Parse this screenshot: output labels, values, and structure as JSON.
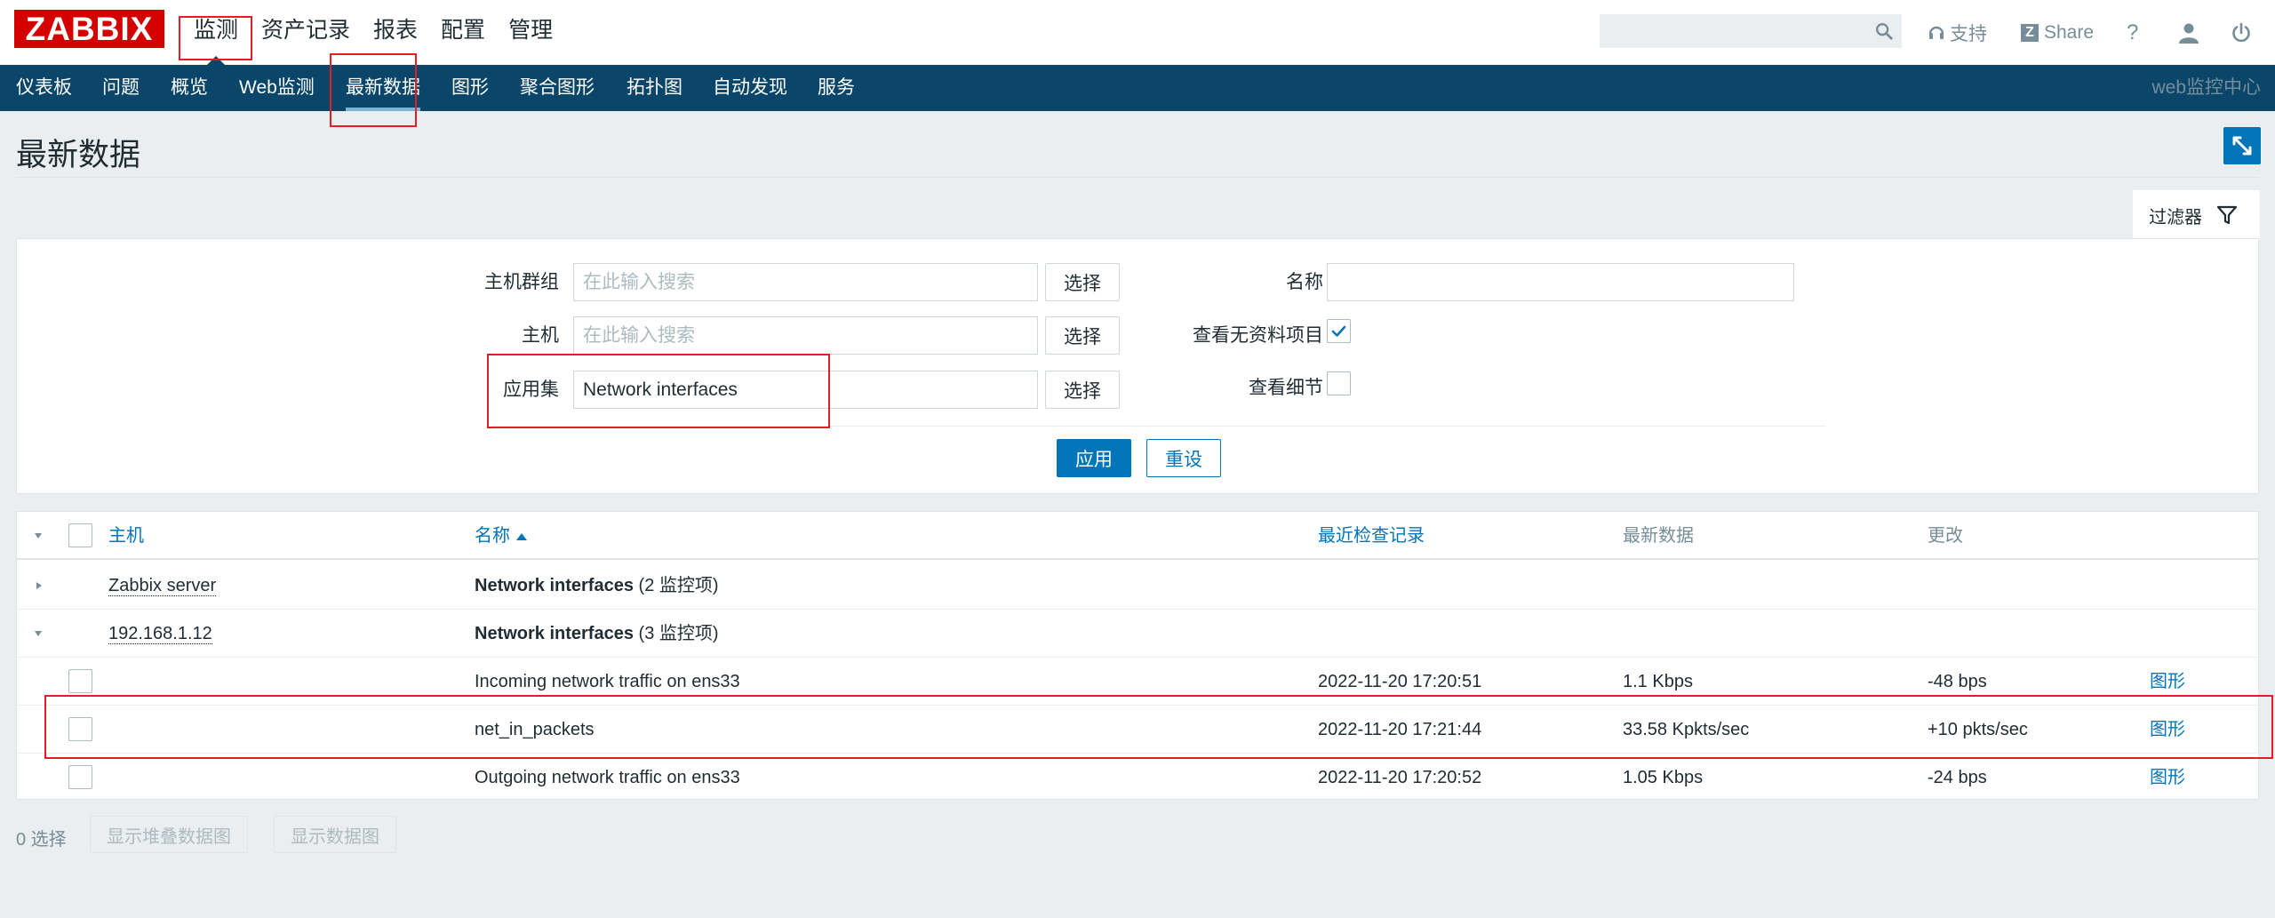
{
  "header": {
    "logo": "ZABBIX",
    "top_menu": [
      "监测",
      "资产记录",
      "报表",
      "配置",
      "管理"
    ],
    "search_placeholder": "",
    "support_label": "支持",
    "share_label": "Share",
    "help_label": "?"
  },
  "nav": {
    "items": [
      "仪表板",
      "问题",
      "概览",
      "Web监测",
      "最新数据",
      "图形",
      "聚合图形",
      "拓扑图",
      "自动发现",
      "服务"
    ],
    "right_label": "web监控中心"
  },
  "page": {
    "title": "最新数据",
    "filter_tab_label": "过滤器"
  },
  "filter": {
    "host_group_label": "主机群组",
    "host_group_placeholder": "在此输入搜索",
    "host_label": "主机",
    "host_placeholder": "在此输入搜索",
    "application_label": "应用集",
    "application_value": "Network interfaces",
    "select_label": "选择",
    "name_label": "名称",
    "name_value": "",
    "show_no_data_label": "查看无资料项目",
    "show_no_data_checked": true,
    "show_details_label": "查看细节",
    "show_details_checked": false,
    "apply_label": "应用",
    "reset_label": "重设"
  },
  "table": {
    "headers": {
      "host": "主机",
      "name": "名称",
      "last_check": "最近检查记录",
      "last_value": "最新数据",
      "change": "更改"
    },
    "groups": [
      {
        "host": "Zabbix server",
        "app": "Network interfaces",
        "count": "(2 监控项)",
        "expanded": false
      },
      {
        "host": "192.168.1.12",
        "app": "Network interfaces",
        "count": "(3 监控项)",
        "expanded": true
      }
    ],
    "items": [
      {
        "name": "Incoming network traffic on ens33",
        "last_check": "2022-11-20 17:20:51",
        "last_value": "1.1 Kbps",
        "change": "-48 bps",
        "link": "图形"
      },
      {
        "name": "net_in_packets",
        "last_check": "2022-11-20 17:21:44",
        "last_value": "33.58 Kpkts/sec",
        "change": "+10 pkts/sec",
        "link": "图形"
      },
      {
        "name": "Outgoing network traffic on ens33",
        "last_check": "2022-11-20 17:20:52",
        "last_value": "1.05 Kbps",
        "change": "-24 bps",
        "link": "图形"
      }
    ]
  },
  "footer": {
    "selected_count": "0 选择",
    "stacked_graph_label": "显示堆叠数据图",
    "graph_label": "显示数据图"
  },
  "colors": {
    "brand_red": "#d40000",
    "nav_bg": "#0a466a",
    "accent_blue": "#0275b8",
    "annotation_red": "#e21e26"
  }
}
